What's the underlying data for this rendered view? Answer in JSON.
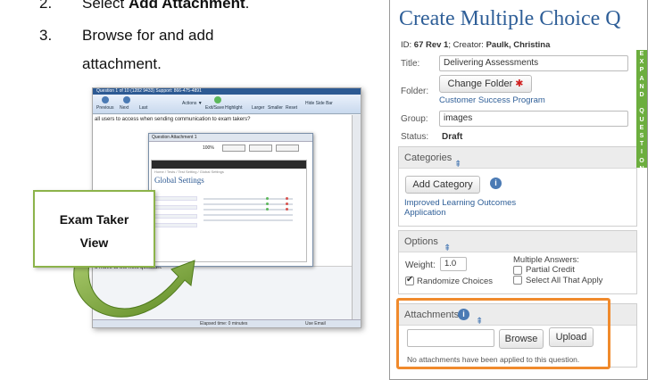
{
  "instructions": {
    "step2_num": "2.",
    "step2_prefix": "Select ",
    "step2_bold": "Add Attachment",
    "step2_suffix": ".",
    "step3_num": "3.",
    "step3_line1": "Browse for and add",
    "step3_line2": "attachment."
  },
  "callout": {
    "text": "Exam Taker\nView"
  },
  "mini_screenshot": {
    "title_bar": "Question 1 of 10 (1282 9433)    Support: 866-475-4891",
    "toolbar": {
      "previous": "Previous",
      "next": "Next",
      "last": "Last",
      "actions": "Actions ▼",
      "exit_save": "Exit/Save",
      "highlight": "Highlight",
      "larger": "Larger",
      "smaller": "Smaller",
      "reset": "Reset",
      "hide_side_bar": "Hide Side Bar"
    },
    "question_text": "all users to access when sending communication to exam takers?",
    "next_question_text": "o move to the next question.",
    "dialog_title": "Question Attachment 1",
    "zoom": "100%",
    "inner_crumb": "Home / Tests / Test Setting / Global Settings",
    "inner_heading": "Global Settings",
    "footer_elapsed": "Elapsed time: 0 minutes",
    "footer_user": "Use Email"
  },
  "form": {
    "title": "Create Multiple Choice Q",
    "meta_prefix": "ID: ",
    "meta_id": "67 Rev 1",
    "meta_creator_label": "; Creator: ",
    "meta_creator": "Paulk, Christina",
    "title_label": "Title:",
    "title_value": "Delivering Assessments",
    "folder_label": "Folder:",
    "change_folder": "Change Folder",
    "folder_link": "Customer Success Program",
    "group_label": "Group:",
    "group_value": "images",
    "status_label": "Status:",
    "status_value": "Draft",
    "categories_header": "Categories",
    "add_category": "Add Category",
    "category_link_1": "Improved Learning Outcomes",
    "category_link_2": "Application",
    "options_header": "Options",
    "weight_label": "Weight:",
    "weight_value": "1.0",
    "multiple_answers": "Multiple Answers:",
    "partial_credit": "Partial Credit",
    "select_all": "Select All That Apply",
    "randomize": "Randomize Choices",
    "attachments_header": "Attachments",
    "browse": "Browse",
    "upload": "Upload",
    "no_attachments": "No attachments have been applied to this question.",
    "expand_letters": [
      "E",
      "X",
      "P",
      "A",
      "N",
      "D",
      " ",
      "Q",
      "U",
      "E",
      "S",
      "T",
      "I",
      "O",
      "N"
    ]
  },
  "colors": {
    "title_blue": "#2f5f98",
    "expand_green": "#6cae3e",
    "highlight_orange": "#f08a2c",
    "callout_border": "#8cb34a"
  }
}
